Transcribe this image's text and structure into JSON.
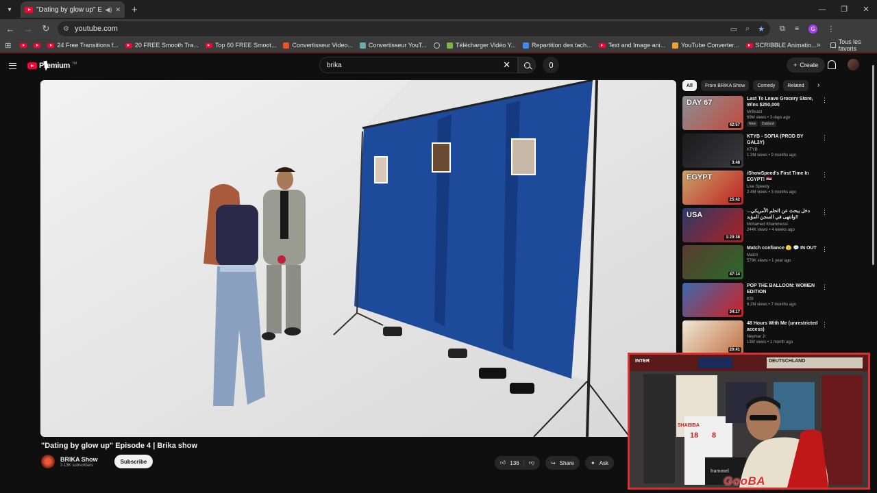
{
  "browser": {
    "tab_title": "\"Dating by glow up\" Episod",
    "url": "youtube.com",
    "bookmarks": [
      {
        "label": "",
        "icon": "youtube"
      },
      {
        "label": "",
        "icon": "youtube"
      },
      {
        "label": "24 Free Transitions f...",
        "icon": "youtube"
      },
      {
        "label": "20 FREE Smooth Tra...",
        "icon": "youtube"
      },
      {
        "label": "Top 60 FREE Smoot...",
        "icon": "youtube"
      },
      {
        "label": "Convertisseur Video...",
        "icon": "z-logo",
        "color": "#e8541e"
      },
      {
        "label": "Convertisseur YouT...",
        "icon": "converter",
        "color": "#6aa9a9"
      },
      {
        "label": "",
        "icon": "globe"
      },
      {
        "label": "Télécharger Vidéo Y...",
        "icon": "download",
        "color": "#7cb342"
      },
      {
        "label": "Repartition des tach...",
        "icon": "docs",
        "color": "#4285f4"
      },
      {
        "label": "Text and Image ani...",
        "icon": "youtube"
      },
      {
        "label": "YouTube Converter...",
        "icon": "converter",
        "color": "#f0a030"
      },
      {
        "label": "SCRIBBLE Animatio...",
        "icon": "youtube"
      }
    ],
    "favorites_folder": "Tous les favoris",
    "profile_initial": "G"
  },
  "youtube": {
    "logo_text": "Premium",
    "logo_tm": "TM",
    "search_value": "brika",
    "create_label": "Create",
    "video_title": "\"Dating by glow up\" Episode 4 | Brika show",
    "channel_name": "BRIKA Show",
    "channel_subs": "3.13K subscribers",
    "subscribe_label": "Subscribe",
    "like_count": "136",
    "share_label": "Share",
    "ask_label": "Ask",
    "filters": [
      "All",
      "From BRIKA Show",
      "Comedy",
      "Related"
    ],
    "recommendations": [
      {
        "title": "Last To Leave Grocery Store, Wins $250,000",
        "channel": "MrBeast",
        "meta": "69M views • 3 days ago",
        "duration": "42:57",
        "badges": [
          "New",
          "Dubbed"
        ],
        "thumb_colors": [
          "#8a8f96",
          "#c44a3a"
        ],
        "thumb_text": "DAY 67"
      },
      {
        "title": "KTYB - SOFIA (PROD BY GAL3Y)",
        "channel": "KTYB",
        "meta": "1.3M views • 9 months ago",
        "duration": "3:48",
        "badges": [],
        "thumb_colors": [
          "#1a1a1a",
          "#3a3a40"
        ],
        "thumb_text": ""
      },
      {
        "title": "iShowSpeed's First Time In EGYPT! 🇪🇬",
        "channel": "Live Speedy",
        "meta": "2.4M views • 3 months ago",
        "duration": "25:42",
        "badges": [],
        "thumb_colors": [
          "#c8a46a",
          "#c02020"
        ],
        "thumb_text": "EGYPT"
      },
      {
        "title": "دخل يبحث عن الحلم الأمريكي... وانتهى في السجن المؤبد!!",
        "channel": "Mohamed Khammessi",
        "meta": "244K views • 4 weeks ago",
        "duration": "1:20:38",
        "badges": [],
        "thumb_colors": [
          "#2a3a6a",
          "#b02020"
        ],
        "thumb_text": "USA"
      },
      {
        "title": "Match confiance 🫣 💬 IN OUT",
        "channel": "Match",
        "meta": "579K views • 1 year ago",
        "duration": "47:14",
        "badges": [],
        "thumb_colors": [
          "#5a3a30",
          "#2a6a2a"
        ],
        "thumb_text": ""
      },
      {
        "title": "POP THE BALLOON: WOMEN EDITION",
        "channel": "KSI",
        "meta": "6.2M views • 7 months ago",
        "duration": "34:17",
        "badges": [],
        "thumb_colors": [
          "#3a6ab0",
          "#d02020"
        ],
        "thumb_text": ""
      },
      {
        "title": "48 Hours With Me (unrestricted access)",
        "channel": "Neymar Jr",
        "meta": "13M views • 1 month ago",
        "duration": "20:41",
        "badges": [],
        "thumb_colors": [
          "#f0e8d8",
          "#c07040"
        ],
        "thumb_text": ""
      }
    ]
  },
  "webcam": {
    "streamer_tag": "GooBA",
    "banner_left": "INTER",
    "banner_right": "DEUTSCHLAND",
    "jersey_name": "SHABIBA",
    "jersey_numbers": [
      "18",
      "8"
    ],
    "box_label": "hummel"
  },
  "colors": {
    "yt_red": "#ff0033",
    "webcam_frame": "#d93030",
    "curtain_blue": "#1e4a9c"
  }
}
